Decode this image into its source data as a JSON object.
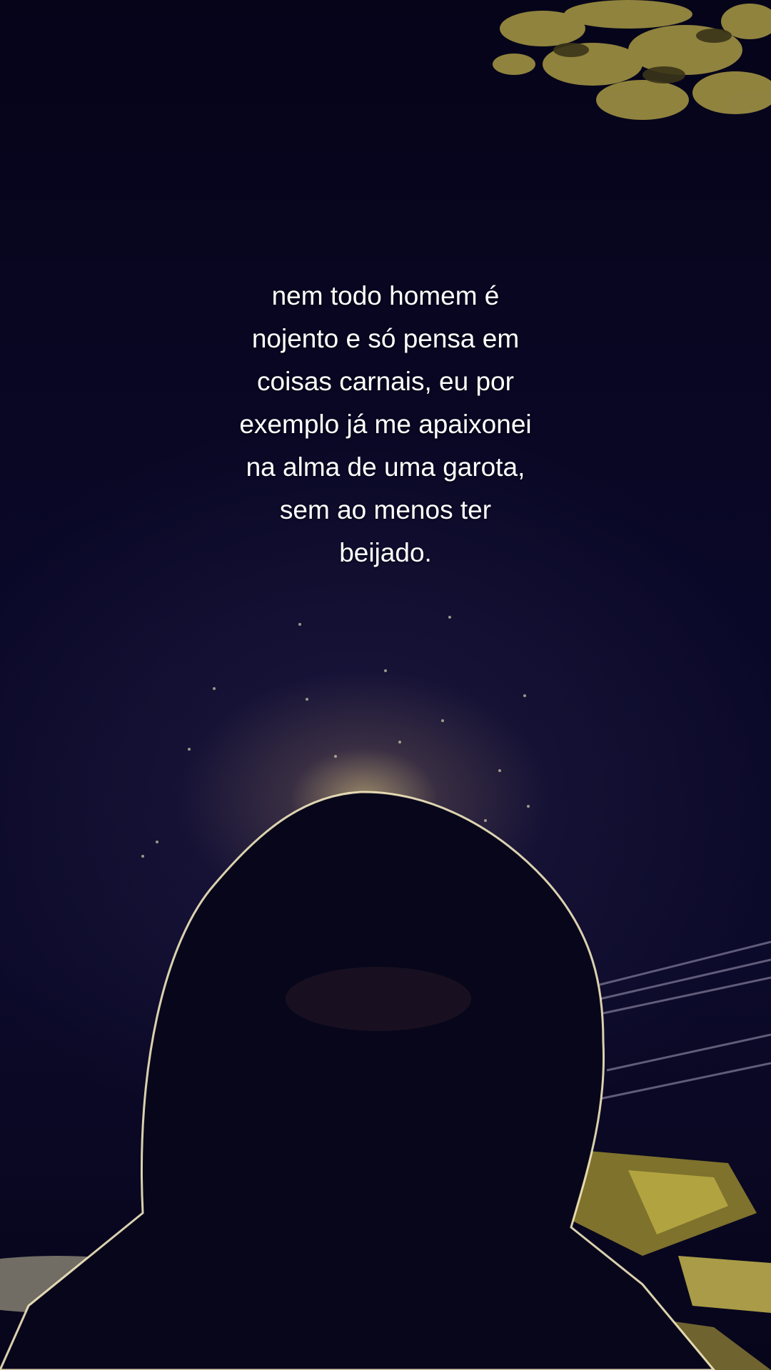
{
  "caption": {
    "lines": [
      "nem todo homem é",
      "nojento e só pensa em",
      "coisas carnais, eu por",
      "exemplo já me apaixonei",
      "na alma de uma garota,",
      "sem ao menos ter",
      "beijado."
    ]
  },
  "colors": {
    "sky": "#07051c",
    "backlight": "#ffe28c",
    "foliage": "#b9a84a",
    "text": "#ffffff"
  }
}
